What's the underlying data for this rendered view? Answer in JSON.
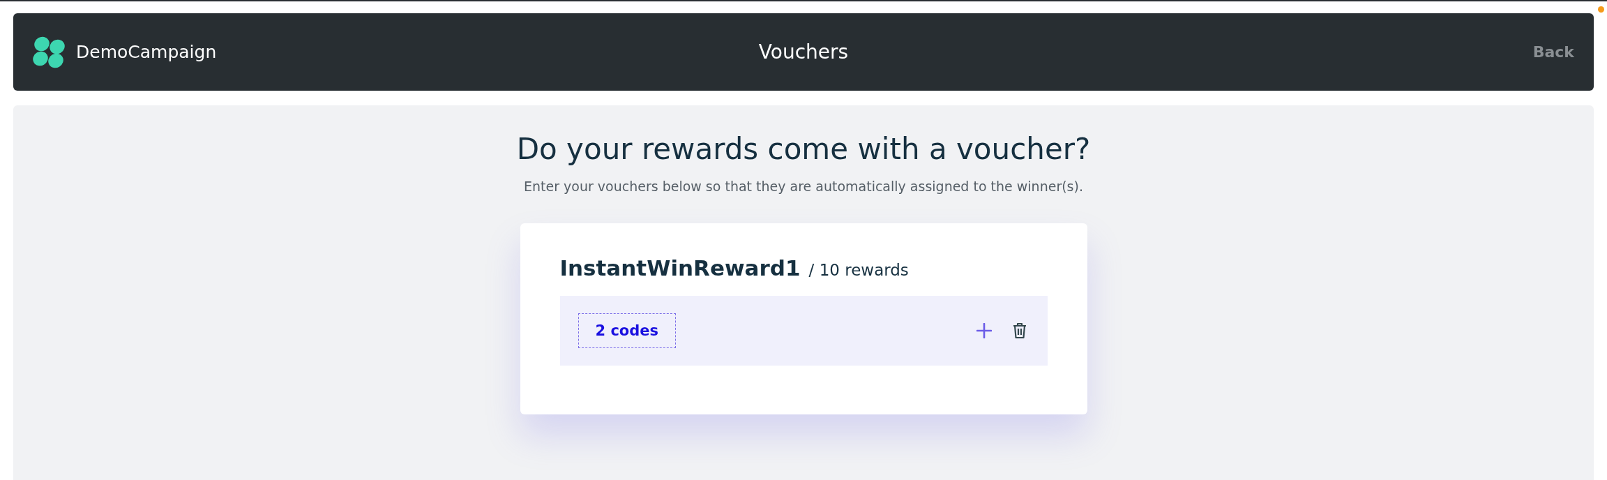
{
  "header": {
    "brand": "DemoCampaign",
    "title": "Vouchers",
    "back": "Back"
  },
  "intro": {
    "heading": "Do your rewards come with a voucher?",
    "subtitle": "Enter your vouchers below so that they are automatically assigned to the winner(s)."
  },
  "rewards": [
    {
      "name": "InstantWinReward1",
      "count": "/ 10 rewards",
      "codes": "2 codes"
    }
  ]
}
